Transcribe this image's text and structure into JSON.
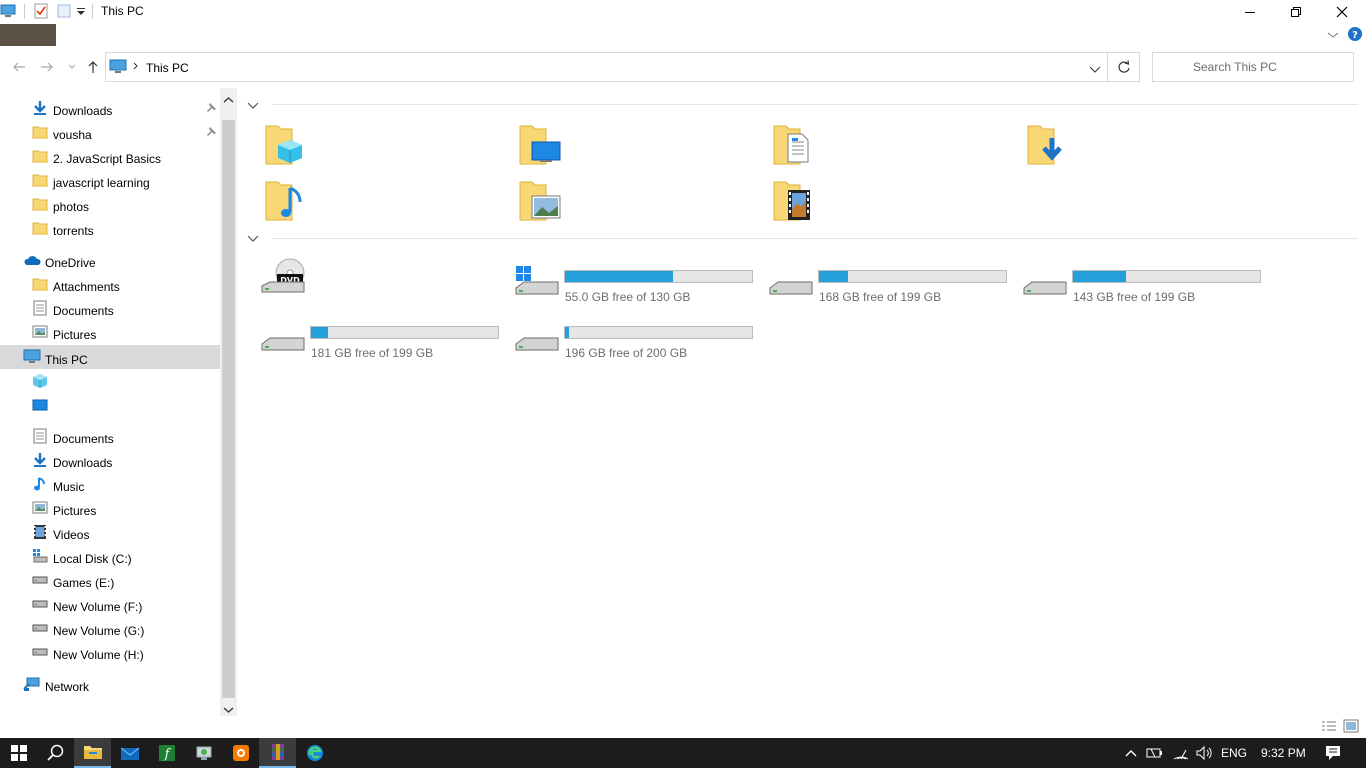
{
  "window": {
    "title": "This PC"
  },
  "address": {
    "path": "This PC",
    "search_placeholder": "Search This PC"
  },
  "navpane": {
    "quick_access": [
      {
        "label": "Downloads",
        "icon": "download-arrow-icon",
        "pinned": true
      },
      {
        "label": "vousha",
        "icon": "folder-icon",
        "pinned": true
      },
      {
        "label": "2. JavaScript Basics",
        "icon": "folder-icon",
        "pinned": false
      },
      {
        "label": "javascript learning",
        "icon": "folder-icon",
        "pinned": false
      },
      {
        "label": "photos",
        "icon": "folder-icon",
        "pinned": false
      },
      {
        "label": "torrents",
        "icon": "folder-icon",
        "pinned": false
      }
    ],
    "onedrive": {
      "label": "OneDrive",
      "items": [
        {
          "label": "Attachments",
          "icon": "folder-icon"
        },
        {
          "label": "Documents",
          "icon": "document-icon"
        },
        {
          "label": "Pictures",
          "icon": "pictures-icon"
        }
      ]
    },
    "this_pc": {
      "label": "This PC",
      "items": [
        {
          "label": "",
          "icon": "3d-objects-icon"
        },
        {
          "label": "",
          "icon": "desktop-icon"
        },
        {
          "label": "Documents",
          "icon": "document-icon"
        },
        {
          "label": "Downloads",
          "icon": "download-arrow-icon"
        },
        {
          "label": "Music",
          "icon": "music-note-icon"
        },
        {
          "label": "Pictures",
          "icon": "pictures-icon"
        },
        {
          "label": "Videos",
          "icon": "videos-icon"
        },
        {
          "label": "Local Disk (C:)",
          "icon": "windows-drive-icon"
        },
        {
          "label": "Games (E:)",
          "icon": "drive-icon"
        },
        {
          "label": "New Volume (F:)",
          "icon": "drive-icon"
        },
        {
          "label": "New Volume (G:)",
          "icon": "drive-icon"
        },
        {
          "label": "New Volume (H:)",
          "icon": "drive-icon"
        }
      ]
    },
    "network": {
      "label": "Network"
    }
  },
  "folders": [
    {
      "icon": "3d-objects-folder-icon"
    },
    {
      "icon": "desktop-folder-icon"
    },
    {
      "icon": "documents-folder-icon"
    },
    {
      "icon": "downloads-folder-icon"
    },
    {
      "icon": "music-folder-icon"
    },
    {
      "icon": "pictures-folder-icon"
    },
    {
      "icon": "videos-folder-icon"
    }
  ],
  "drives": [
    {
      "icon": "dvd-drive-icon",
      "free_text": "",
      "used_fraction": null
    },
    {
      "icon": "windows-drive-icon",
      "free_text": "55.0 GB free of 130 GB",
      "used_fraction": 0.577
    },
    {
      "icon": "drive-icon",
      "free_text": "168 GB free of 199 GB",
      "used_fraction": 0.156
    },
    {
      "icon": "drive-icon",
      "free_text": "143 GB free of 199 GB",
      "used_fraction": 0.281
    },
    {
      "icon": "drive-icon",
      "free_text": "181 GB free of 199 GB",
      "used_fraction": 0.09
    },
    {
      "icon": "drive-icon",
      "free_text": "196 GB free of 200 GB",
      "used_fraction": 0.02
    }
  ],
  "taskbar": {
    "language": "ENG",
    "time": "9:32 PM"
  },
  "colors": {
    "accent": "#26a0da",
    "folder": "#f8d775",
    "taskbar": "#1c1c1c",
    "selection": "#d9d9d9"
  }
}
